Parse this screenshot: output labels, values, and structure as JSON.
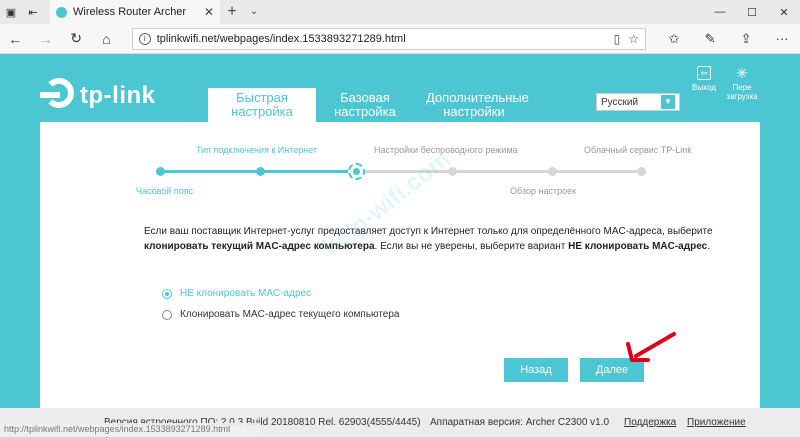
{
  "browser": {
    "tab_title": "Wireless Router Archer",
    "url": "tplinkwifi.net/webpages/index.1533893271289.html"
  },
  "router": {
    "brand": "tp-link",
    "tabs": [
      {
        "label": "Быстрая настройка"
      },
      {
        "label": "Базовая настройка"
      },
      {
        "label": "Дополнительные настройки"
      }
    ],
    "language": "Русский",
    "exit_label": "Выход",
    "reboot_label": "Пере загрузка",
    "steps": {
      "timezone": "Часовой пояс",
      "connection_type": "Тип подключения к Интернет",
      "wireless": "Настройки беспроводного режима",
      "summary": "Обзор настроек",
      "cloud": "Облачный сервис TP-Link"
    },
    "description": {
      "part1": "Если ваш поставщик Интернет-услуг предоставляет доступ к Интернет только для определённого MAC-адреса, выберите ",
      "bold1": "клонировать текущий MAC-адрес компьютера",
      "part2": ". Если вы не уверены, выберите вариант ",
      "bold2": "НЕ клонировать MAC-адрес",
      "part3": "."
    },
    "options": [
      {
        "label": "НЕ клонировать MAC-адрес",
        "selected": true
      },
      {
        "label": "Клонировать MAC-адрес текущего компьютера",
        "selected": false
      }
    ],
    "buttons": {
      "back": "Назад",
      "next": "Далее"
    },
    "watermark": "help-wifi.com",
    "footer": {
      "firmware": "Версия встроенного ПО: 2.0.3 Build 20180810 Rel. 62903(4555/4445)",
      "hardware": "Аппаратная версия: Archer C2300 v1.0",
      "support": "Поддержка",
      "app": "Приложение"
    },
    "status_url": "http://tplinkwifi.net/webpages/index.1533893271289.html"
  },
  "colors": {
    "accent": "#4dc6d3",
    "annotation": "#e0001b"
  }
}
